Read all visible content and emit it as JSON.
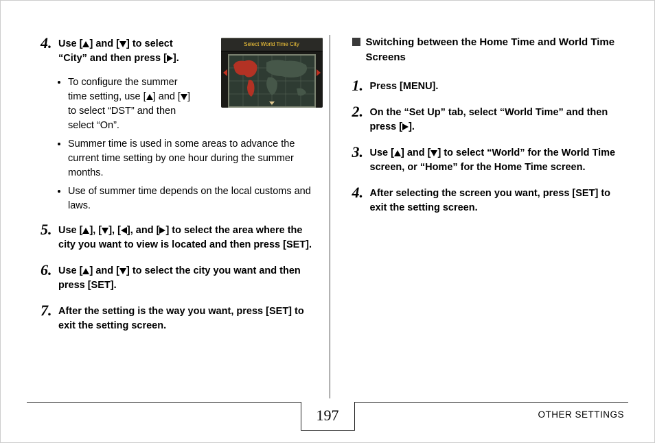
{
  "left": {
    "steps": [
      {
        "n": "4.",
        "parts": [
          "Use [",
          "UP",
          "] and [",
          "DOWN",
          "] to select “City” and then press [",
          "RIGHT",
          "]."
        ],
        "bullets": [
          {
            "parts": [
              "To configure the summer time setting, use [",
              "UP",
              "] and [",
              "DOWN",
              "] to select “DST” and then select “On”."
            ]
          },
          {
            "parts": [
              "Summer time is used in some areas to advance the current time setting by one hour during the summer months."
            ]
          },
          {
            "parts": [
              "Use of summer time depends on the local customs and laws."
            ]
          }
        ]
      },
      {
        "n": "5.",
        "parts": [
          "Use [",
          "UP",
          "], [",
          "DOWN",
          "], [",
          "LEFT",
          "], and [",
          "RIGHT",
          "] to select the area where the city you want to view is located and then press [SET]."
        ]
      },
      {
        "n": "6.",
        "parts": [
          "Use [",
          "UP",
          "] and [",
          "DOWN",
          "] to select the city you want and then press [SET]."
        ]
      },
      {
        "n": "7.",
        "parts": [
          "After the setting is the way you want, press [SET] to exit the setting screen."
        ]
      }
    ],
    "screenshot_title": "Select World Time City"
  },
  "right": {
    "heading": "Switching between the Home Time and World Time Screens",
    "steps": [
      {
        "n": "1.",
        "parts": [
          "Press [MENU]."
        ]
      },
      {
        "n": "2.",
        "parts": [
          "On the “Set Up” tab, select “World Time” and then press [",
          "RIGHT",
          "]."
        ]
      },
      {
        "n": "3.",
        "parts": [
          "Use [",
          "UP",
          "] and [",
          "DOWN",
          "] to select “World” for the World Time screen, or “Home” for the Home Time screen."
        ]
      },
      {
        "n": "4.",
        "parts": [
          "After selecting the screen you want, press [SET] to exit the setting screen."
        ]
      }
    ]
  },
  "footer": {
    "page": "197",
    "section": "OTHER SETTINGS"
  }
}
